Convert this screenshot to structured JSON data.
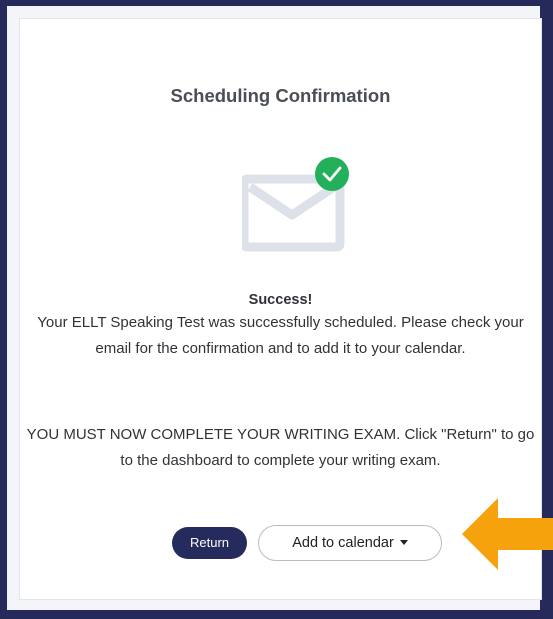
{
  "dialog": {
    "title": "Scheduling Confirmation",
    "success_title": "Success!",
    "message_line1": "Your ELLT Speaking Test was successfully scheduled. Please check your email for the confirmation and to add it to your calendar.",
    "message_line2": "YOU MUST NOW COMPLETE YOUR WRITING EXAM. Click \"Return\" to go to the dashboard to complete your writing exam."
  },
  "buttons": {
    "return_label": "Return",
    "calendar_label": "Add to calendar"
  },
  "icons": {
    "envelope": "envelope-icon",
    "check": "check-badge-icon",
    "caret": "caret-down-icon",
    "arrow": "arrow-left-icon"
  },
  "colors": {
    "frame": "#252a5a",
    "primary_button": "#262b5e",
    "success_badge": "#22b05a",
    "envelope": "#dde2ea",
    "arrow": "#f5a20c"
  }
}
